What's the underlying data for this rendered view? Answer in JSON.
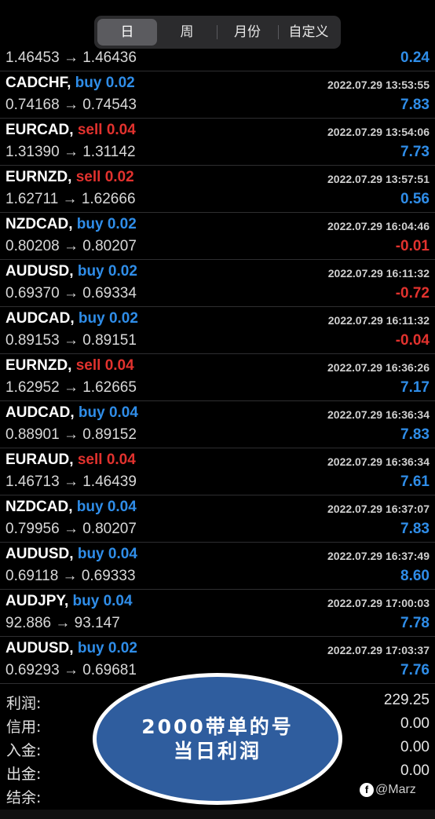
{
  "period_tabs": [
    {
      "label": "日",
      "active": true
    },
    {
      "label": "周",
      "active": false
    },
    {
      "label": "月份",
      "active": false
    },
    {
      "label": "自定义",
      "active": false
    }
  ],
  "partial_row": {
    "prices": "1.46453 → 1.46436",
    "profit": "0.24"
  },
  "trades": [
    {
      "symbol": "CADCHF,",
      "side": "buy 0.02",
      "side_type": "buy",
      "time": "2022.07.29 13:53:55",
      "prices": "0.74168 → 0.74543",
      "profit": "7.83",
      "profit_sign": "pos"
    },
    {
      "symbol": "EURCAD,",
      "side": "sell 0.04",
      "side_type": "sell",
      "time": "2022.07.29 13:54:06",
      "prices": "1.31390 → 1.31142",
      "profit": "7.73",
      "profit_sign": "pos"
    },
    {
      "symbol": "EURNZD,",
      "side": "sell 0.02",
      "side_type": "sell",
      "time": "2022.07.29 13:57:51",
      "prices": "1.62711 → 1.62666",
      "profit": "0.56",
      "profit_sign": "pos"
    },
    {
      "symbol": "NZDCAD,",
      "side": "buy 0.02",
      "side_type": "buy",
      "time": "2022.07.29 16:04:46",
      "prices": "0.80208 → 0.80207",
      "profit": "-0.01",
      "profit_sign": "neg"
    },
    {
      "symbol": "AUDUSD,",
      "side": "buy 0.02",
      "side_type": "buy",
      "time": "2022.07.29 16:11:32",
      "prices": "0.69370 → 0.69334",
      "profit": "-0.72",
      "profit_sign": "neg"
    },
    {
      "symbol": "AUDCAD,",
      "side": "buy 0.02",
      "side_type": "buy",
      "time": "2022.07.29 16:11:32",
      "prices": "0.89153 → 0.89151",
      "profit": "-0.04",
      "profit_sign": "neg"
    },
    {
      "symbol": "EURNZD,",
      "side": "sell 0.04",
      "side_type": "sell",
      "time": "2022.07.29 16:36:26",
      "prices": "1.62952 → 1.62665",
      "profit": "7.17",
      "profit_sign": "pos"
    },
    {
      "symbol": "AUDCAD,",
      "side": "buy 0.04",
      "side_type": "buy",
      "time": "2022.07.29 16:36:34",
      "prices": "0.88901 → 0.89152",
      "profit": "7.83",
      "profit_sign": "pos"
    },
    {
      "symbol": "EURAUD,",
      "side": "sell 0.04",
      "side_type": "sell",
      "time": "2022.07.29 16:36:34",
      "prices": "1.46713 → 1.46439",
      "profit": "7.61",
      "profit_sign": "pos"
    },
    {
      "symbol": "NZDCAD,",
      "side": "buy 0.04",
      "side_type": "buy",
      "time": "2022.07.29 16:37:07",
      "prices": "0.79956 → 0.80207",
      "profit": "7.83",
      "profit_sign": "pos"
    },
    {
      "symbol": "AUDUSD,",
      "side": "buy 0.04",
      "side_type": "buy",
      "time": "2022.07.29 16:37:49",
      "prices": "0.69118 → 0.69333",
      "profit": "8.60",
      "profit_sign": "pos"
    },
    {
      "symbol": "AUDJPY,",
      "side": "buy 0.04",
      "side_type": "buy",
      "time": "2022.07.29 17:00:03",
      "prices": "92.886 → 93.147",
      "profit": "7.78",
      "profit_sign": "pos"
    },
    {
      "symbol": "AUDUSD,",
      "side": "buy 0.02",
      "side_type": "buy",
      "time": "2022.07.29 17:03:37",
      "prices": "0.69293 → 0.69681",
      "profit": "7.76",
      "profit_sign": "pos"
    }
  ],
  "summary": [
    {
      "label": "利润:",
      "value": "229.25"
    },
    {
      "label": "信用:",
      "value": "0.00"
    },
    {
      "label": "入金:",
      "value": "0.00"
    },
    {
      "label": "出金:",
      "value": "0.00"
    },
    {
      "label": "结余:",
      "value": ""
    }
  ],
  "overlay": {
    "line1": "2000带单的号",
    "line2": "当日利润"
  },
  "watermark": {
    "icon": "platform-logo-icon",
    "text": "@Marz"
  },
  "colors": {
    "buy": "#2f8de8",
    "sell": "#e2322e",
    "background": "#000000",
    "overlay": "#2f5d9e"
  }
}
